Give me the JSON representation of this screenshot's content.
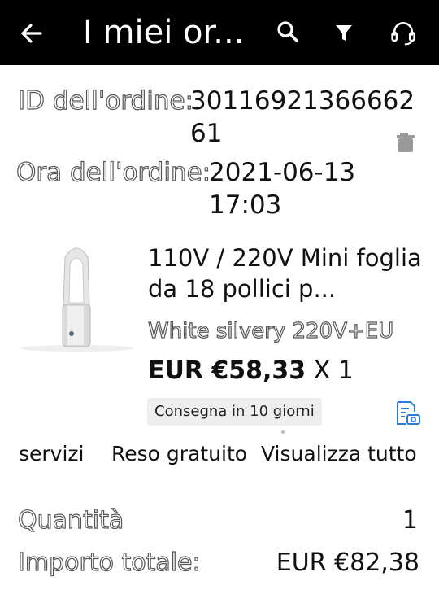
{
  "header": {
    "title": "I miei or...",
    "icons": [
      "back-arrow-icon",
      "search-icon",
      "filter-icon",
      "headset-icon"
    ]
  },
  "order": {
    "id_label": "ID dell'ordine:",
    "id_value": "3011692136666261",
    "time_label": "Ora dell'ordine:",
    "time_value": "2021-06-13 17:03"
  },
  "product": {
    "title": "110V / 220V Mini foglia da 18 pollici p...",
    "variant": "White silvery 220V+EU",
    "price": "EUR €58,33",
    "quantity_text": "X 1",
    "delivery": "Consegna in 10 giorni"
  },
  "actions": {
    "services": "servizi",
    "free_return": "Reso gratuito",
    "view_all": "Visualizza tutto"
  },
  "summary": {
    "quantity_label": "Quantità",
    "quantity_value": "1",
    "total_label": "Importo totale:",
    "total_value": "EUR €82,38"
  },
  "colors": {
    "header_bg": "#000000",
    "accent_blue": "#2b7bd6",
    "trash_gray": "#9a9a9a"
  }
}
